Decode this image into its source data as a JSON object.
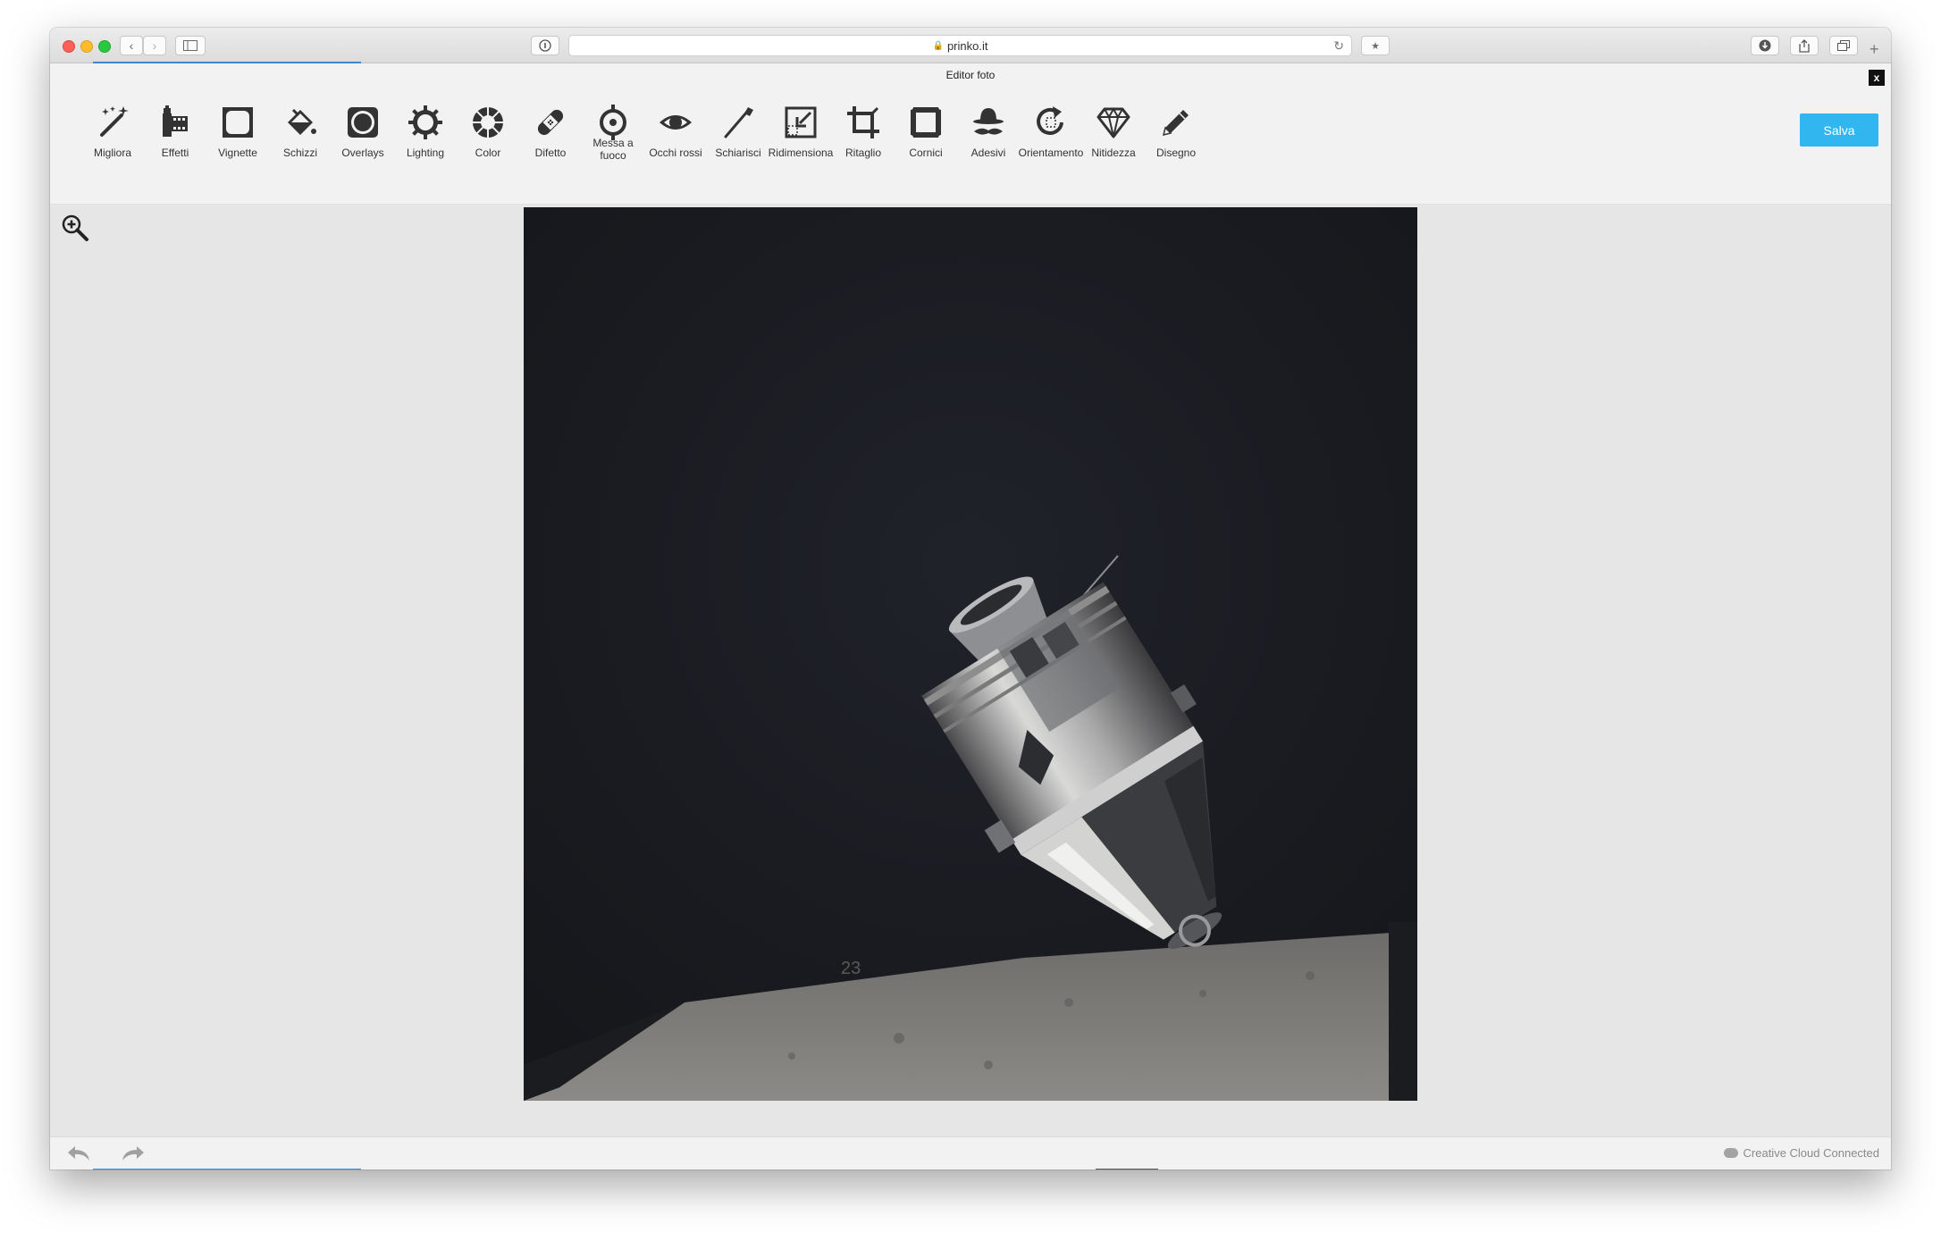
{
  "browser": {
    "url": "prinko.it"
  },
  "editor": {
    "title": "Editor foto",
    "close_label": "x",
    "save_label": "Salva",
    "tools": [
      {
        "label": "Migliora",
        "icon": "magic-wand-icon"
      },
      {
        "label": "Effetti",
        "icon": "film-icon"
      },
      {
        "label": "Vignette",
        "icon": "vignette-icon"
      },
      {
        "label": "Schizzi",
        "icon": "paint-bucket-icon"
      },
      {
        "label": "Overlays",
        "icon": "overlay-icon"
      },
      {
        "label": "Lighting",
        "icon": "sun-icon"
      },
      {
        "label": "Color",
        "icon": "color-wheel-icon"
      },
      {
        "label": "Difetto",
        "icon": "bandage-icon"
      },
      {
        "label": "Messa a fuoco",
        "icon": "focus-target-icon"
      },
      {
        "label": "Occhi rossi",
        "icon": "eye-icon"
      },
      {
        "label": "Schiarisci",
        "icon": "brush-icon"
      },
      {
        "label": "Ridimensiona",
        "icon": "resize-icon"
      },
      {
        "label": "Ritaglio",
        "icon": "crop-icon"
      },
      {
        "label": "Cornici",
        "icon": "frame-icon"
      },
      {
        "label": "Adesivi",
        "icon": "hat-mustache-icon"
      },
      {
        "label": "Orientamento",
        "icon": "rotate-icon"
      },
      {
        "label": "Nitidezza",
        "icon": "diamond-icon"
      },
      {
        "label": "Disegno",
        "icon": "pencil-icon"
      }
    ],
    "photo_number": "23"
  },
  "footer": {
    "cc_status": "Creative Cloud Connected"
  },
  "colors": {
    "accent": "#31b6f0",
    "toolbar_bg": "#f2f2f2",
    "canvas_bg": "#e6e6e6",
    "icon": "#333333"
  }
}
